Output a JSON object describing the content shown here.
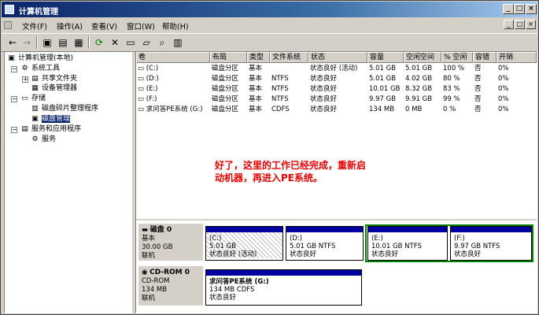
{
  "window": {
    "title": "计算机管理",
    "min": "_",
    "max": "□",
    "close": "×"
  },
  "menu": [
    "文件(F)",
    "操作(A)",
    "查看(V)",
    "窗口(W)",
    "帮助(H)"
  ],
  "mdi": {
    "min": "_",
    "max": "□",
    "close": "×"
  },
  "tree": [
    {
      "label": "计算机管理(本地)",
      "level": 0
    },
    {
      "label": "系统工具",
      "level": 1
    },
    {
      "label": "共享文件夹",
      "level": 2
    },
    {
      "label": "设备管理器",
      "level": 2
    },
    {
      "label": "存储",
      "level": 1
    },
    {
      "label": "磁盘碎片整理程序",
      "level": 2
    },
    {
      "label": "磁盘管理",
      "level": 2
    },
    {
      "label": "服务和应用程序",
      "level": 1
    },
    {
      "label": "服务",
      "level": 2
    }
  ],
  "columns": [
    "卷",
    "布局",
    "类型",
    "文件系统",
    "状态",
    "容量",
    "空闲空间",
    "% 空闲",
    "容错",
    "开销"
  ],
  "volumes": [
    {
      "name": "(C:)",
      "layout": "磁盘分区",
      "type": "基本",
      "fs": "",
      "status": "状态良好 (活动)",
      "cap": "5.01 GB",
      "free": "5.01 GB",
      "pct": "100 %",
      "ft": "否",
      "ov": "0%"
    },
    {
      "name": "(D:)",
      "layout": "磁盘分区",
      "type": "基本",
      "fs": "NTFS",
      "status": "状态良好",
      "cap": "5.01 GB",
      "free": "4.02 GB",
      "pct": "80 %",
      "ft": "否",
      "ov": "0%"
    },
    {
      "name": "(E:)",
      "layout": "磁盘分区",
      "type": "基本",
      "fs": "NTFS",
      "status": "状态良好",
      "cap": "10.01 GB",
      "free": "8.32 GB",
      "pct": "83 %",
      "ft": "否",
      "ov": "0%"
    },
    {
      "name": "(F:)",
      "layout": "磁盘分区",
      "type": "基本",
      "fs": "NTFS",
      "status": "状态良好",
      "cap": "9.97 GB",
      "free": "9.91 GB",
      "pct": "99 %",
      "ft": "否",
      "ov": "0%"
    },
    {
      "name": "求问答PE系统 (G:)",
      "layout": "磁盘分区",
      "type": "基本",
      "fs": "CDFS",
      "status": "状态良好",
      "cap": "134 MB",
      "free": "0 MB",
      "pct": "0 %",
      "ft": "否",
      "ov": "0%"
    }
  ],
  "note": {
    "line1": "好了，这里的工作已经完成，重新启",
    "line2": "动机器，再进入PE系统。"
  },
  "disk0": {
    "name": "磁盘 0",
    "kind": "基本",
    "size": "30.00 GB",
    "state": "联机",
    "parts": [
      {
        "name": "(C:)",
        "size": "5.01 GB",
        "status": "状态良好 (活动)"
      },
      {
        "name": "(D:)",
        "size": "5.01 GB NTFS",
        "status": "状态良好"
      },
      {
        "name": "(E:)",
        "size": "10.01 GB NTFS",
        "status": "状态良好"
      },
      {
        "name": "(F:)",
        "size": "9.97 GB NTFS",
        "status": "状态良好"
      }
    ]
  },
  "cdrom": {
    "name": "CD-ROM 0",
    "kind": "CD-ROM",
    "size": "134 MB",
    "state": "联机",
    "part": {
      "name": "求问答PE系统  (G:)",
      "size": "134 MB CDFS",
      "status": "状态良好"
    }
  },
  "colors": {
    "title_start": "#0a246a",
    "title_end": "#a6caf0",
    "partition_bar": "#0000a0",
    "note": "#e00000",
    "selection": "#008000"
  }
}
